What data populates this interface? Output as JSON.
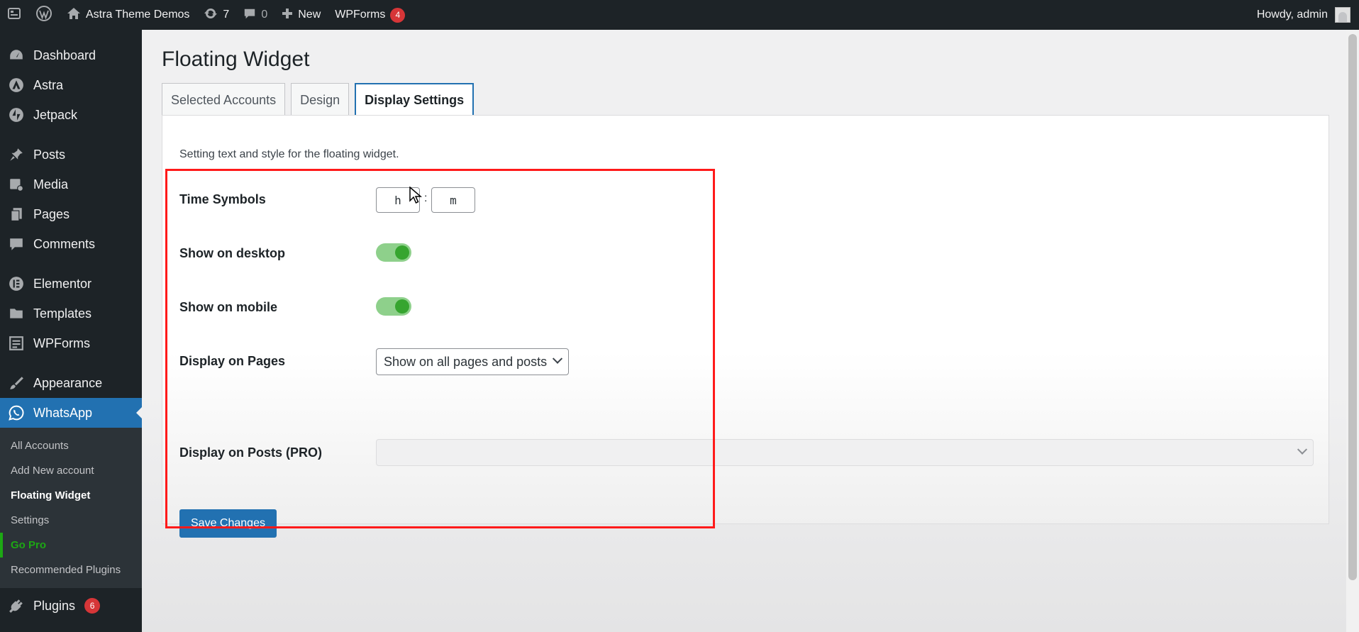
{
  "admin_bar": {
    "site_name": "Astra Theme Demos",
    "updates_count": "7",
    "comments_count": "0",
    "new_label": "New",
    "wpforms_label": "WPForms",
    "wpforms_badge": "4",
    "greeting": "Howdy, admin"
  },
  "sidebar": {
    "items": [
      {
        "label": "Dashboard",
        "icon": "dashboard-icon"
      },
      {
        "label": "Astra",
        "icon": "astra-icon"
      },
      {
        "label": "Jetpack",
        "icon": "jetpack-icon"
      },
      {
        "label": "Posts",
        "icon": "pushpin-icon"
      },
      {
        "label": "Media",
        "icon": "media-icon"
      },
      {
        "label": "Pages",
        "icon": "pages-icon"
      },
      {
        "label": "Comments",
        "icon": "comment-icon"
      },
      {
        "label": "Elementor",
        "icon": "elementor-icon"
      },
      {
        "label": "Templates",
        "icon": "folder-icon"
      },
      {
        "label": "WPForms",
        "icon": "form-icon"
      },
      {
        "label": "Appearance",
        "icon": "brush-icon"
      },
      {
        "label": "WhatsApp",
        "icon": "whatsapp-icon"
      },
      {
        "label": "Plugins",
        "icon": "plug-icon"
      }
    ],
    "plugins_badge": "6",
    "whatsapp_submenu": [
      {
        "label": "All Accounts"
      },
      {
        "label": "Add New account"
      },
      {
        "label": "Floating Widget"
      },
      {
        "label": "Settings"
      },
      {
        "label": "Go Pro"
      },
      {
        "label": "Recommended Plugins"
      }
    ]
  },
  "main": {
    "title": "Floating Widget",
    "tabs": [
      {
        "label": "Selected Accounts"
      },
      {
        "label": "Design"
      },
      {
        "label": "Display Settings"
      }
    ],
    "description": "Setting text and style for the floating widget.",
    "fields": {
      "time_symbols_label": "Time Symbols",
      "hour_value": "h",
      "time_separator": ":",
      "minute_value": "m",
      "show_desktop_label": "Show on desktop",
      "show_desktop_on": true,
      "show_mobile_label": "Show on mobile",
      "show_mobile_on": true,
      "display_pages_label": "Display on Pages",
      "display_pages_value": "Show on all pages and posts",
      "display_posts_label": "Display on Posts (PRO)",
      "display_posts_value": ""
    },
    "save_label": "Save Changes"
  },
  "colors": {
    "admin_dark": "#1d2327",
    "accent_blue": "#2271b1",
    "toggle_green": "#36a52f",
    "highlight_red": "#ff1a1a",
    "go_pro_green": "#1da814"
  }
}
